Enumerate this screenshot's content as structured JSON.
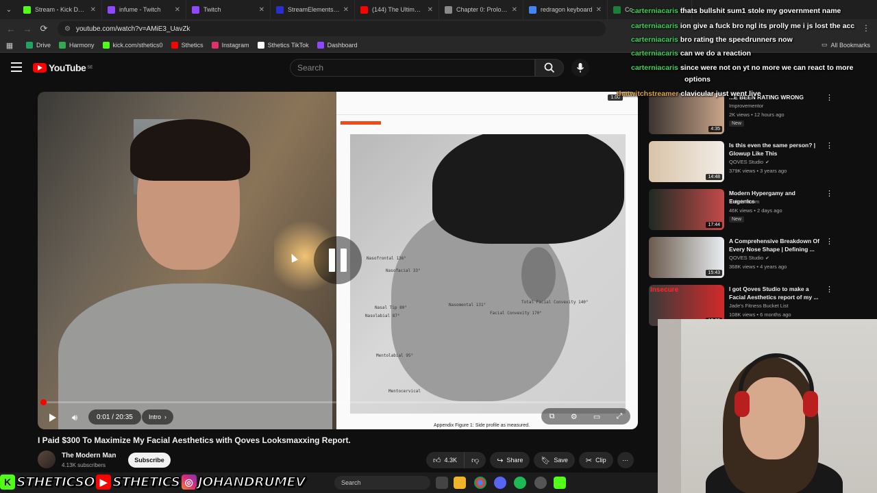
{
  "browser": {
    "tabs": [
      {
        "label": "Stream - Kick Dashboard",
        "color": "#53fc18"
      },
      {
        "label": "infume - Twitch",
        "color": "#9146ff"
      },
      {
        "label": "Twitch",
        "color": "#9146ff"
      },
      {
        "label": "StreamElements - Bot",
        "color": "#2a2fd0"
      },
      {
        "label": "(144) The Ultimate G",
        "color": "#ff0000"
      },
      {
        "label": "Chapter 0: Prologue",
        "color": "#8a8a8a"
      },
      {
        "label": "redragon keyboard",
        "color": "#4285f4"
      },
      {
        "label": "Co",
        "color": "#188038"
      }
    ],
    "url": "youtube.com/watch?v=AMiE3_UavZk",
    "bookmarks": [
      {
        "label": "Drive",
        "color": "#1fa463"
      },
      {
        "label": "Harmony",
        "color": "#34a853"
      },
      {
        "label": "kick.com/sthetics0",
        "color": "#53fc18"
      },
      {
        "label": "Sthetics",
        "color": "#ff0000"
      },
      {
        "label": "Instagram",
        "color": "#e1306c"
      },
      {
        "label": "Sthetics TikTok",
        "color": "#ffffff"
      },
      {
        "label": "Dashboard",
        "color": "#9146ff"
      }
    ],
    "all_bookmarks": "All Bookmarks"
  },
  "youtube": {
    "logo_text": "YouTube",
    "logo_region": "SE",
    "search_placeholder": "Search",
    "video": {
      "title": "I Paid $300 To Maximize My Facial Aesthetics with Qoves Looksmaxxing Report.",
      "time": "0:01 / 20:35",
      "chapter": "Intro",
      "progress": 0.001,
      "playback_rate": "1.00",
      "doc_caption": "Appendix Figure 1: Side profile as measured.",
      "measure_labels": [
        "Nasofrontal 136°",
        "Nasofacial 33°",
        "Nasomental 131°",
        "Facial Convexity 170°",
        "Total Facial Convexity 140°",
        "Nasal Tip 80°",
        "Nasolabial 87°",
        "Mentolabial 95°",
        "Mentocervical"
      ]
    },
    "channel": {
      "name": "The Modern Man",
      "subscribers": "4.13K subscribers",
      "subscribe_label": "Subscribe"
    },
    "actions": {
      "likes": "4.3K",
      "share": "Share",
      "save": "Save",
      "clip": "Clip"
    },
    "recommendations": [
      {
        "title": "...E BEEN RATING WRONG",
        "channel": "Improvementor",
        "meta": "2K views • 12 hours ago",
        "duration": "4:35",
        "badge": "New",
        "thumb": [
          "#3b3430",
          "#c9a58a"
        ]
      },
      {
        "title": "Is this even the same person? | Glowup Like This",
        "channel": "QOVES Studio",
        "meta": "379K views • 3 years ago",
        "duration": "14:48",
        "badge": "",
        "thumb": [
          "#d9c3a8",
          "#f1ece6"
        ]
      },
      {
        "title": "Modern Hypergamy and Eugenics",
        "channel": "Rehab Room",
        "meta": "46K views • 2 days ago",
        "duration": "17:44",
        "badge": "New",
        "thumb": [
          "#1e2a22",
          "#c34a4a"
        ]
      },
      {
        "title": "A Comprehensive Breakdown Of Every Nose Shape | Defining ...",
        "channel": "QOVES Studio",
        "meta": "368K views • 4 years ago",
        "duration": "15:43",
        "badge": "",
        "thumb": [
          "#6a5a4c",
          "#e9eef2"
        ]
      },
      {
        "title": "I got Qoves Studio to make a Facial Aesthetics report of my ...",
        "channel": "Jade's Fitness Bucket List",
        "meta": "108K views • 6 months ago",
        "duration": "13:09",
        "badge": "",
        "thumb": [
          "#3a3a3a",
          "#d12a2a"
        ]
      }
    ],
    "rec_thumb_text": "Insecure"
  },
  "chat": [
    {
      "user": "carterniacaris",
      "message": "thats bullshit sum1 stole my government name",
      "user_color": "green"
    },
    {
      "user": "carterniacaris",
      "message": "ion give a fuck bro ngl its prolly me i js lost the acc",
      "user_color": "green"
    },
    {
      "user": "carterniacaris",
      "message": "bro rating the speedrunners now",
      "user_color": "green"
    },
    {
      "user": "carterniacaris",
      "message": "can we do a reaction",
      "user_color": "green"
    },
    {
      "user": "carterniacaris",
      "message": "since were not on yt no more we can react to more",
      "user_color": "green"
    },
    {
      "user": "",
      "message": "options",
      "user_color": "green"
    },
    {
      "user": "thatwitchstreamer",
      "message": "clavicular just went live",
      "user_color": "orange"
    }
  ],
  "stream_banner": {
    "kick_handle": "STHETICSO",
    "yt_handle": "STHETICS",
    "ig_handle": "JOHANDRUMEV"
  },
  "taskbar": {
    "search_placeholder": "Search"
  }
}
